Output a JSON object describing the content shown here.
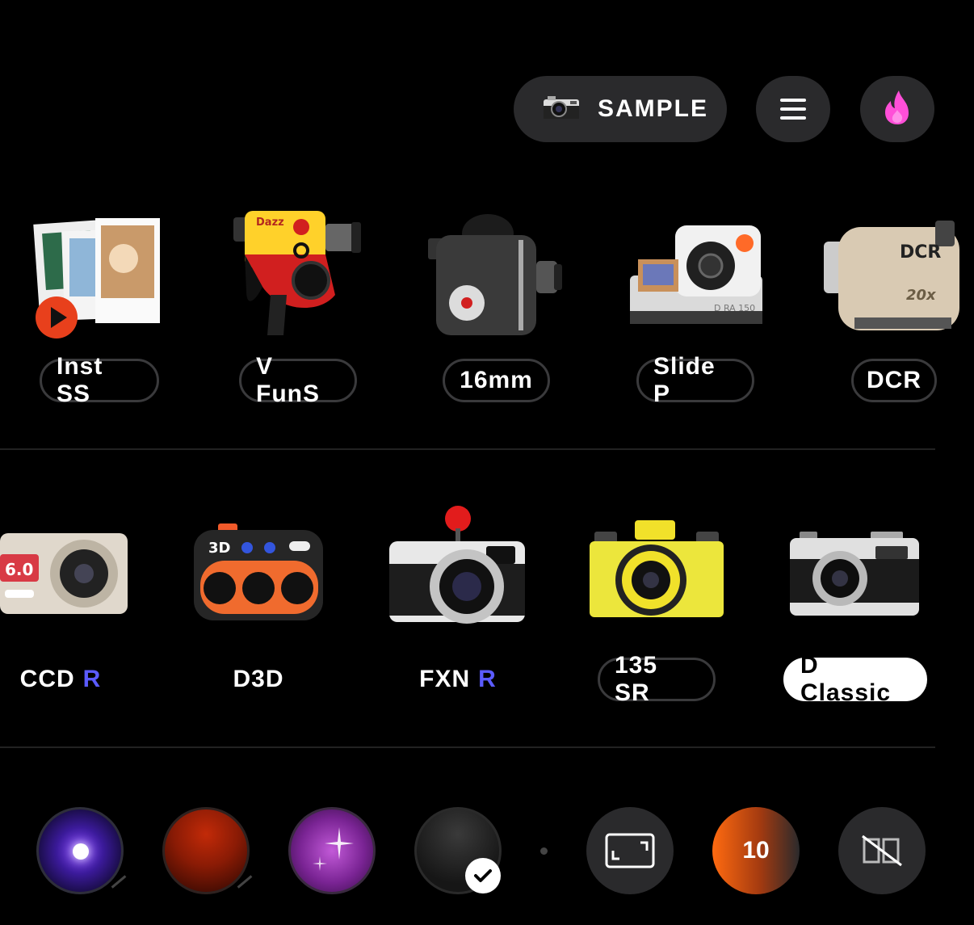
{
  "header": {
    "sample_label": "SAMPLE",
    "sample_icon": "camera-icon",
    "menu_icon": "hamburger-menu-icon",
    "premium_icon": "flame-icon",
    "flame_color": "#ff4fd8"
  },
  "row1": [
    {
      "label": "Inst SS",
      "icon": "instant-slideshow-camera-icon"
    },
    {
      "label": "V FunS",
      "icon": "video-fun-camera-icon"
    },
    {
      "label": "16mm",
      "icon": "16mm-film-camera-icon"
    },
    {
      "label": "Slide P",
      "icon": "slide-projector-camera-icon"
    },
    {
      "label": "DCR",
      "icon": "dcr-camcorder-icon"
    }
  ],
  "row1_art_text": {
    "dazz": "Dazz",
    "dra": "D RA 150",
    "dcr": "DCR",
    "zoom": "20x"
  },
  "row2": [
    {
      "label": "CCD",
      "badge": "R",
      "icon": "ccd-camera-icon"
    },
    {
      "label": "D3D",
      "icon": "d3d-camera-icon"
    },
    {
      "label": "FXN",
      "badge": "R",
      "icon": "fxn-camera-icon"
    },
    {
      "label": "135 SR",
      "icon": "135sr-camera-icon"
    },
    {
      "label": "D Classic",
      "icon": "d-classic-camera-icon",
      "selected": true
    }
  ],
  "row2_art_text": {
    "ccd": "6.0",
    "d3d": "3D"
  },
  "controls": {
    "lenses": [
      "lens-flare-filter",
      "red-filter",
      "sparkle-filter",
      "no-filter-selected"
    ],
    "timer_value": "10",
    "frame_icon": "aspect-ratio-icon",
    "date_icon": "date-stamp-off-icon",
    "badge_color": "#5b5bff"
  }
}
